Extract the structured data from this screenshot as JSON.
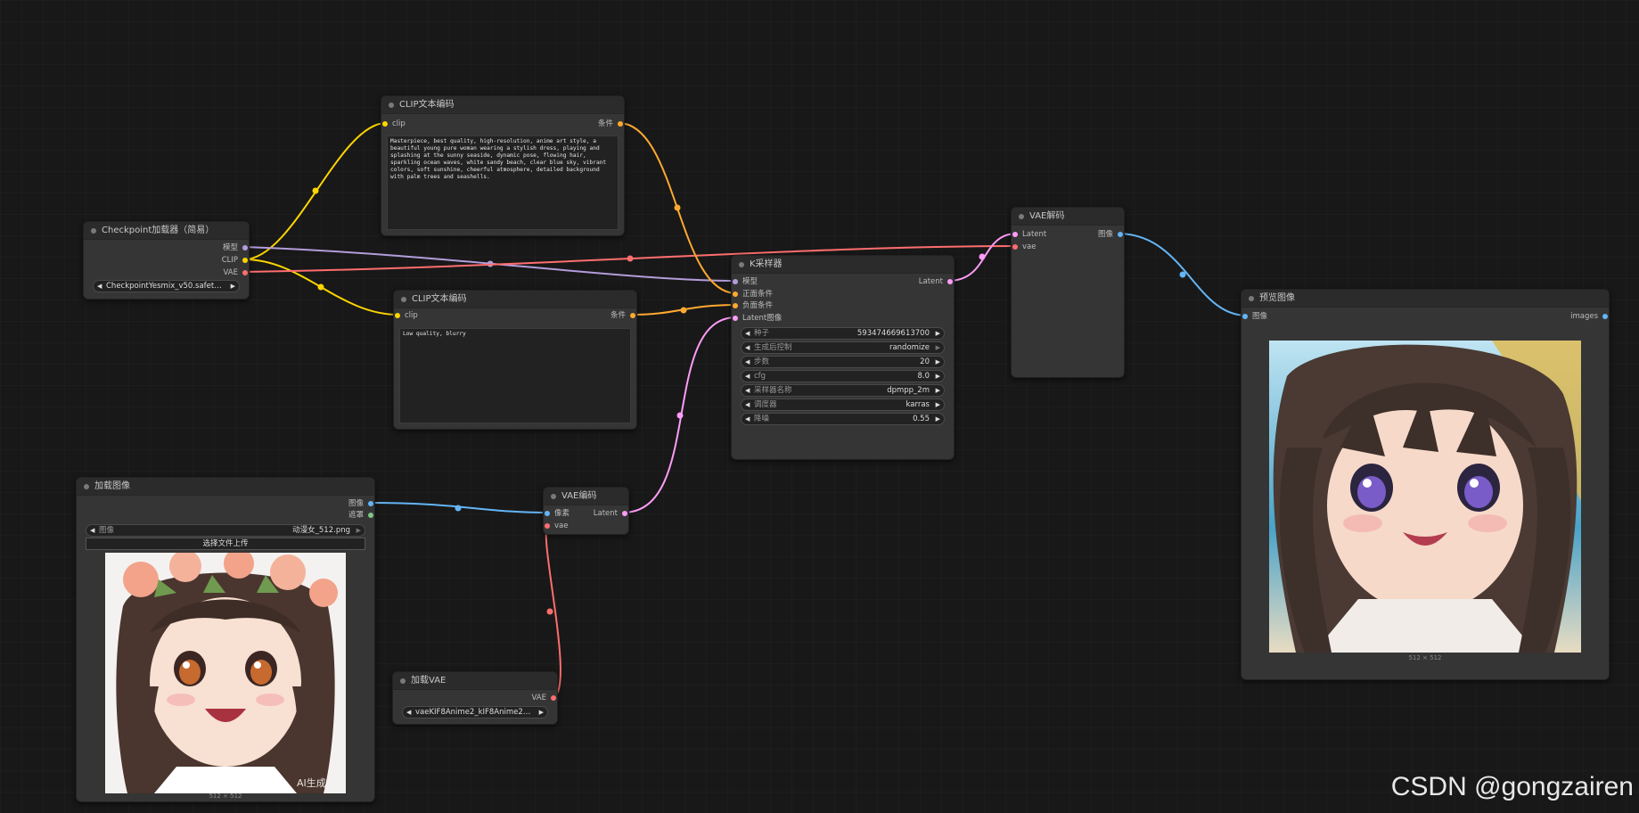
{
  "nodes": {
    "checkpoint": {
      "title": "Checkpoint加载器（简易）",
      "outputs": [
        "模型",
        "CLIP",
        "VAE"
      ],
      "ckpt_name": "CheckpointYesmix_v50.safeten ..."
    },
    "clip_pos": {
      "title": "CLIP文本编码",
      "input": "clip",
      "output": "条件",
      "text": "Masterpiece, best quality, high-resolution, anime art style, a beautiful young pure woman wearing a stylish dress, playing and splashing at the sunny seaside, dynamic pose, flowing hair, sparkling ocean waves, white sandy beach, clear blue sky, vibrant colors, soft sunshine, cheerful atmosphere, detailed background with palm trees and seashells."
    },
    "clip_neg": {
      "title": "CLIP文本编码",
      "input": "clip",
      "output": "条件",
      "text": "Low quality, blurry"
    },
    "ksampler": {
      "title": "K采样器",
      "inputs": [
        "模型",
        "正面条件",
        "负面条件",
        "Latent图像"
      ],
      "output": "Latent",
      "widgets": [
        {
          "label": "种子",
          "value": "593474669613700"
        },
        {
          "label": "生成后控制",
          "value": "randomize"
        },
        {
          "label": "步数",
          "value": "20"
        },
        {
          "label": "cfg",
          "value": "8.0"
        },
        {
          "label": "采样器名称",
          "value": "dpmpp_2m"
        },
        {
          "label": "调度器",
          "value": "karras"
        },
        {
          "label": "降噪",
          "value": "0.55"
        }
      ]
    },
    "vae_decode": {
      "title": "VAE解码",
      "inputs": [
        "Latent",
        "vae"
      ],
      "output": "图像"
    },
    "preview": {
      "title": "预览图像",
      "input": "图像",
      "output": "images",
      "size_label": "512 × 512"
    },
    "load_image": {
      "title": "加载图像",
      "outputs": [
        "图像",
        "遮罩"
      ],
      "image_label": "图像",
      "image_value": "动漫女_512.png",
      "upload_label": "选择文件上传",
      "size_label": "512 × 512",
      "image_mark": "AI生成"
    },
    "vae_encode": {
      "title": "VAE编码",
      "inputs": [
        "像素",
        "vae"
      ],
      "output": "Latent"
    },
    "load_vae": {
      "title": "加载VAE",
      "output": "VAE",
      "vae_name": "vaeKIF8Anime2_kIF8Anime2V ..."
    }
  },
  "colors": {
    "model": "#b39ddb",
    "clip": "#ffd500",
    "vae": "#ff6e6e",
    "conditioning": "#ffa931",
    "latent": "#ff9cf9",
    "image": "#64b5f6",
    "mask": "#81c784"
  },
  "watermark": "CSDN @gongzairen"
}
